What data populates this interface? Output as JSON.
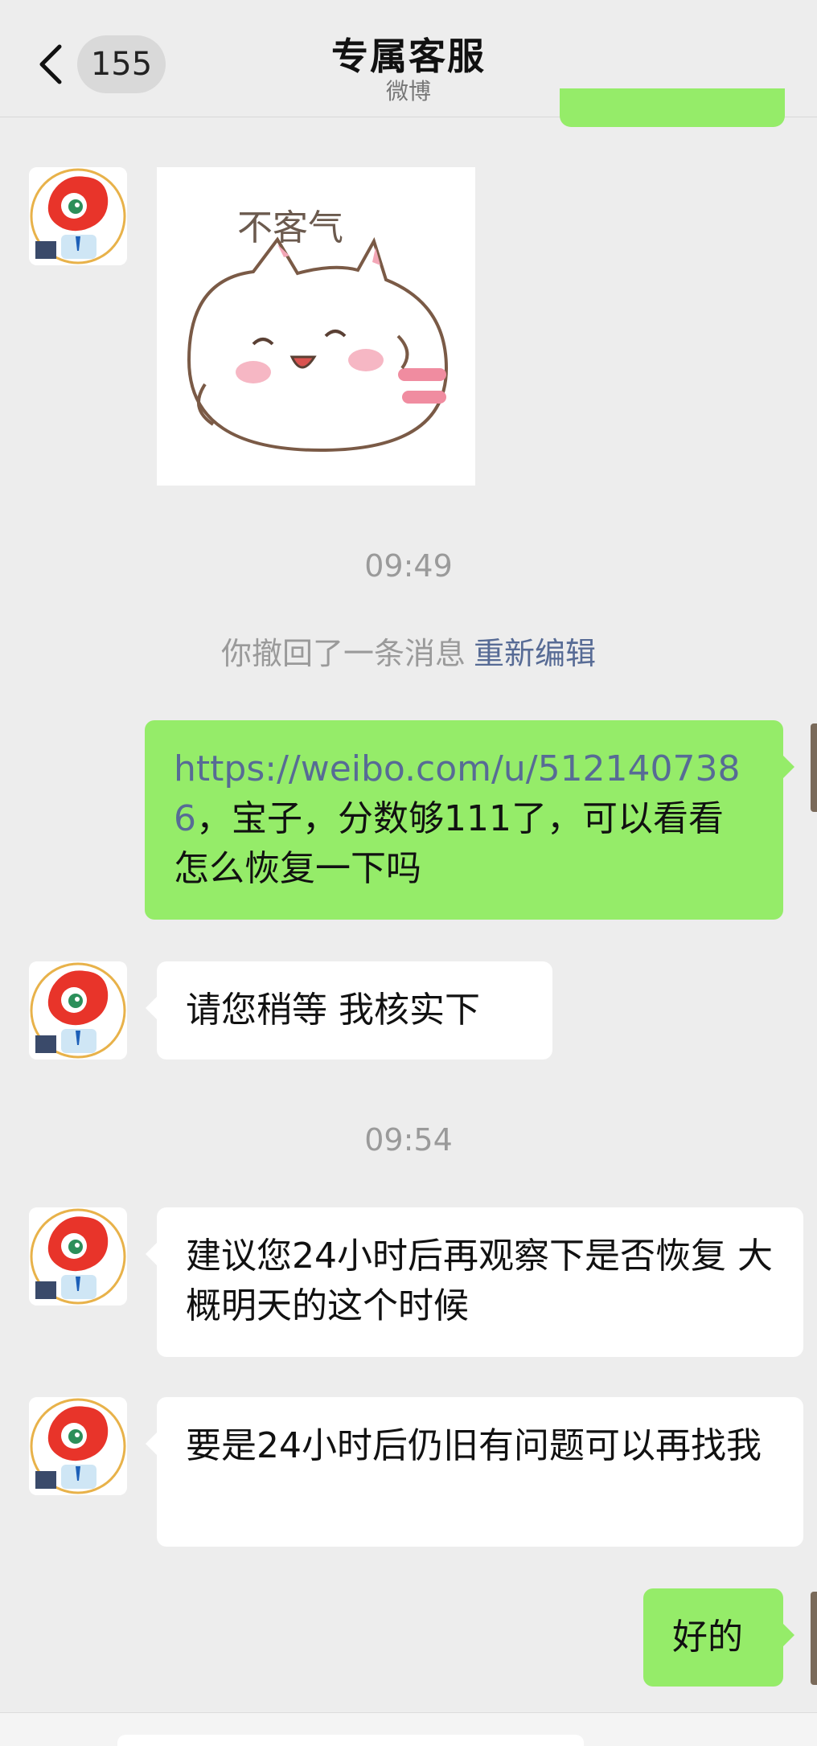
{
  "header": {
    "back_icon": "chevron-left-icon",
    "unread_count": "155",
    "title": "专属客服",
    "subtitle": "微博"
  },
  "sticker": {
    "text": "不客气",
    "icon": "cat-sticker"
  },
  "messages": [
    {
      "time": "09:49"
    },
    {
      "recall_text": "你撤回了一条消息",
      "recall_action": "重新编辑"
    },
    {
      "link": "https://weibo.com/u/5121407386",
      "text": "，宝子，分数够111了，可以看看怎么恢复一下吗"
    },
    {
      "text": "请您稍等 我核实下"
    },
    {
      "time": "09:54"
    },
    {
      "text": "建议您24小时后再观察下是否恢复 大概明天的这个时候"
    },
    {
      "text": "要是24小时后仍旧有问题可以再找我"
    },
    {
      "text": "好的"
    }
  ],
  "colors": {
    "background": "#ededed",
    "outgoing_bubble": "#95ec69",
    "incoming_bubble": "#ffffff",
    "link": "#576b95",
    "meta_text": "#9a9a9a"
  }
}
